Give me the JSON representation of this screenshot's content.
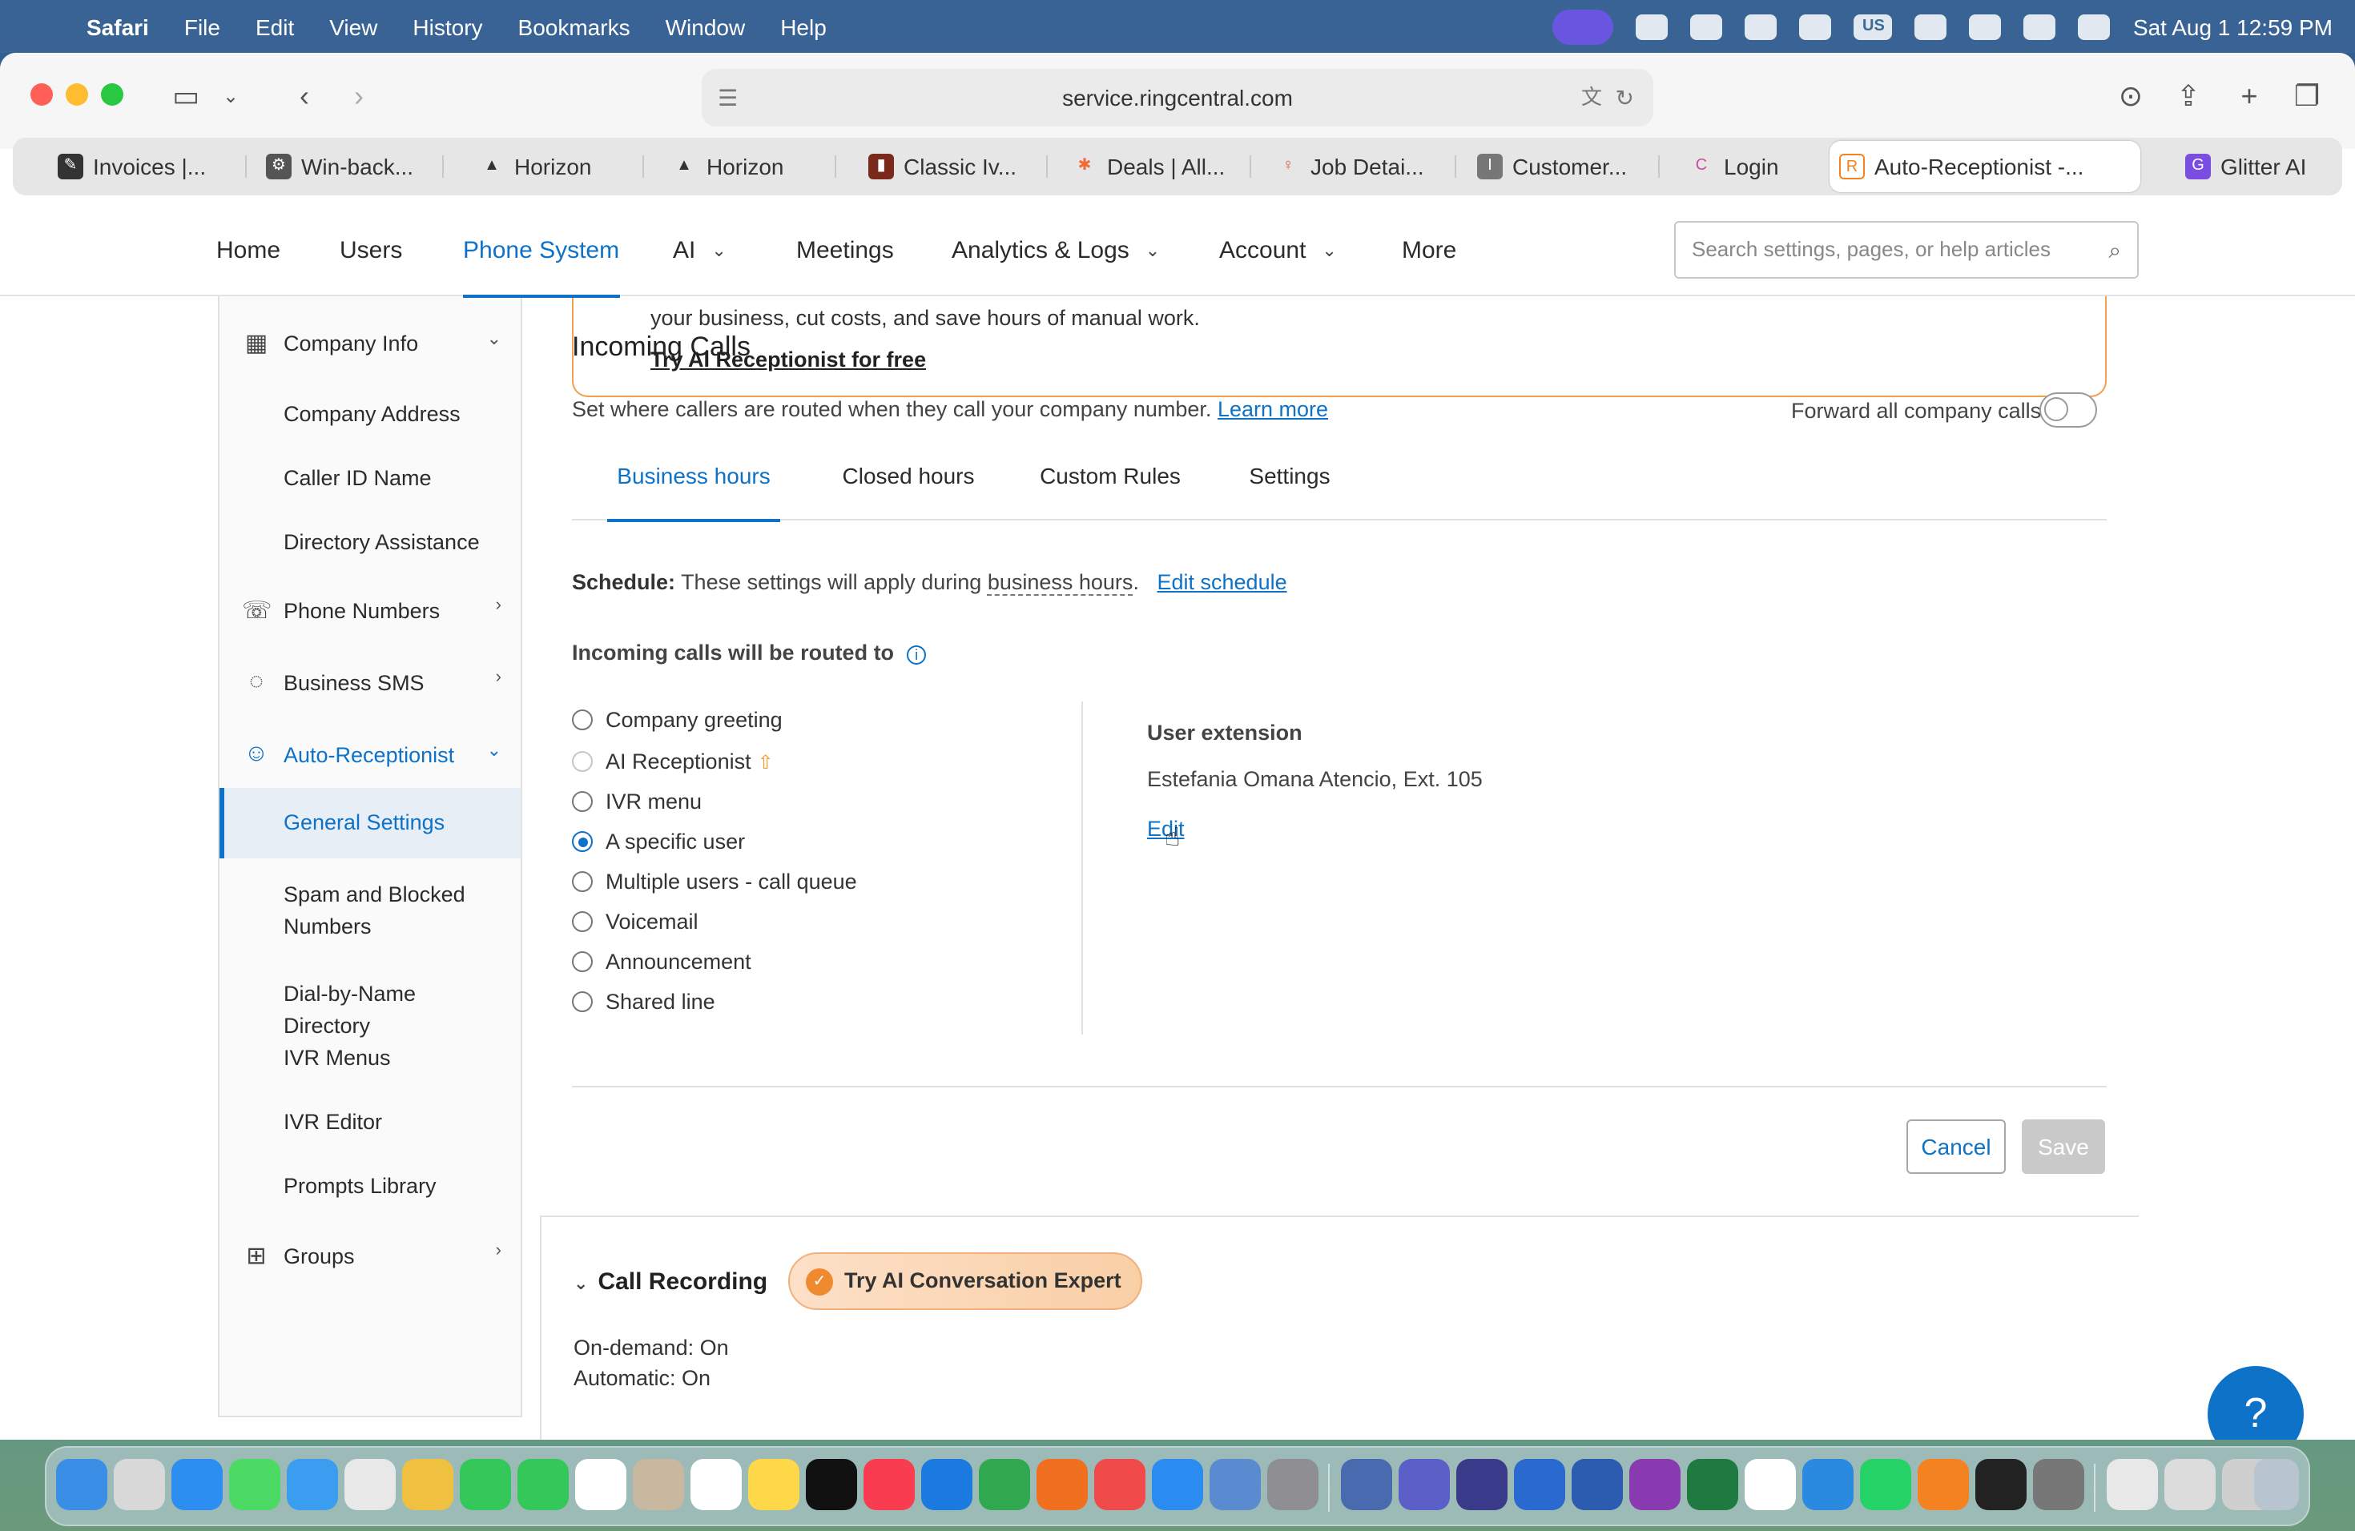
{
  "menubar": {
    "app": "Safari",
    "items": [
      "File",
      "Edit",
      "View",
      "History",
      "Bookmarks",
      "Window",
      "Help"
    ],
    "datetime": "Sat Aug 1  12:59 PM",
    "input_source": "US"
  },
  "browser": {
    "url": "service.ringcentral.com",
    "tabs": [
      {
        "label": "Invoices |...",
        "fav": "✎"
      },
      {
        "label": "Win-back...",
        "fav": "⚙"
      },
      {
        "label": "Horizon",
        "fav": "▲"
      },
      {
        "label": "Horizon",
        "fav": "▲"
      },
      {
        "label": "Classic Iv...",
        "fav": "▮"
      },
      {
        "label": "Deals | All...",
        "fav": "✱"
      },
      {
        "label": "Job Detai...",
        "fav": "♀"
      },
      {
        "label": "Customer...",
        "fav": "I"
      },
      {
        "label": "Login",
        "fav": "C"
      },
      {
        "label": "Auto-Receptionist -...",
        "fav": "R"
      },
      {
        "label": "Glitter AI",
        "fav": "G"
      }
    ]
  },
  "topnav": {
    "items": [
      "Home",
      "Users",
      "Phone System",
      "AI",
      "Meetings",
      "Analytics & Logs",
      "Account",
      "More"
    ],
    "search_placeholder": "Search settings, pages, or help articles"
  },
  "sidebar": {
    "company_info": "Company Info",
    "company_address": "Company Address",
    "caller_id_name": "Caller ID Name",
    "directory_assistance": "Directory Assistance",
    "phone_numbers": "Phone Numbers",
    "business_sms": "Business SMS",
    "auto_receptionist": "Auto-Receptionist",
    "general_settings": "General Settings",
    "spam_blocked": "Spam and Blocked Numbers",
    "dial_by_name": "Dial-by-Name Directory",
    "ivr_menus": "IVR Menus",
    "ivr_editor": "IVR Editor",
    "prompts_library": "Prompts Library",
    "groups": "Groups"
  },
  "promo": {
    "text": "your business, cut costs, and save hours of manual work.",
    "link": "Try AI Receptionist for free"
  },
  "incoming": {
    "title": "Incoming Calls",
    "description": "Set where callers are routed when they call your company number.",
    "learn_more": "Learn more",
    "forward_label": "Forward all company calls",
    "tabs": [
      "Business hours",
      "Closed hours",
      "Custom Rules",
      "Settings"
    ],
    "schedule_label": "Schedule:",
    "schedule_text": "These settings will apply during",
    "schedule_hours": "business hours",
    "schedule_period": ".",
    "edit_schedule": "Edit schedule",
    "routed_label": "Incoming calls will be routed to",
    "options": [
      "Company greeting",
      "AI Receptionist",
      "IVR menu",
      "A specific user",
      "Multiple users - call queue",
      "Voicemail",
      "Announcement",
      "Shared line"
    ],
    "selected_option": "A specific user",
    "user_extension_title": "User extension",
    "user_extension_value": "Estefania Omana Atencio, Ext. 105",
    "edit_link": "Edit",
    "cancel": "Cancel",
    "save": "Save"
  },
  "call_recording": {
    "title": "Call Recording",
    "badge": "Try AI Conversation Expert",
    "on_demand": "On-demand: On",
    "automatic": "Automatic: On"
  },
  "colors": {
    "accent": "#0d72c8",
    "promo_border": "#f0a050"
  }
}
